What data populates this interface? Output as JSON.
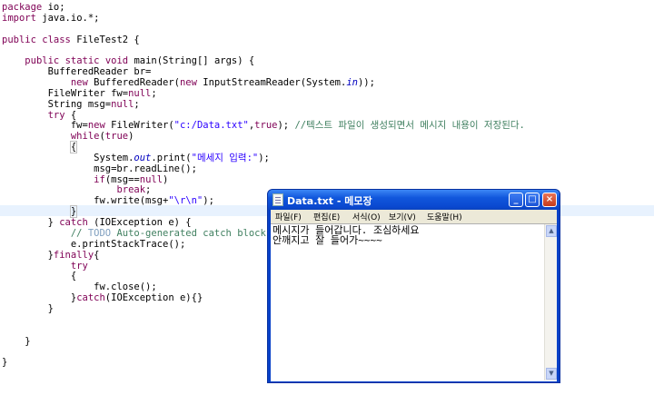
{
  "editor": {
    "lines": [
      "package io;",
      "import java.io.*;",
      "",
      "public class FileTest2 {",
      "",
      "    public static void main(String[] args) {",
      "        BufferedReader br=",
      "            new BufferedReader(new InputStreamReader(System.in));",
      "        FileWriter fw=null;",
      "        String msg=null;",
      "        try {",
      "            fw=new FileWriter(\"c:/Data.txt\",true); //텍스트 파일이 생성되면서 메시지 내용이 저장된다.",
      "            while(true)",
      "            {",
      "                System.out.print(\"메세지 입력:\");",
      "                msg=br.readLine();",
      "                if(msg==null)",
      "                    break;",
      "                fw.write(msg+\"\\r\\n\");",
      "            }",
      "        } catch (IOException e) {",
      "            // TODO Auto-generated catch block",
      "            e.printStackTrace();",
      "        }finally{",
      "            try",
      "            {",
      "                fw.close();",
      "            }catch(IOException e){}",
      "        }",
      "",
      "",
      "    }",
      "",
      "}"
    ]
  },
  "notepad": {
    "title": "Data.txt - 메모장",
    "menu": [
      "파일(F)",
      "편집(E)",
      "서식(O)",
      "보기(V)",
      "도움말(H)"
    ],
    "content": "메시지가 들어갑니다. 조심하세요\n안깨지고 잘 들어가~~~~",
    "buttons": {
      "minimize": "_",
      "maximize": "□",
      "close": "×"
    },
    "scroll_up": "▲",
    "scroll_down": "▼"
  }
}
